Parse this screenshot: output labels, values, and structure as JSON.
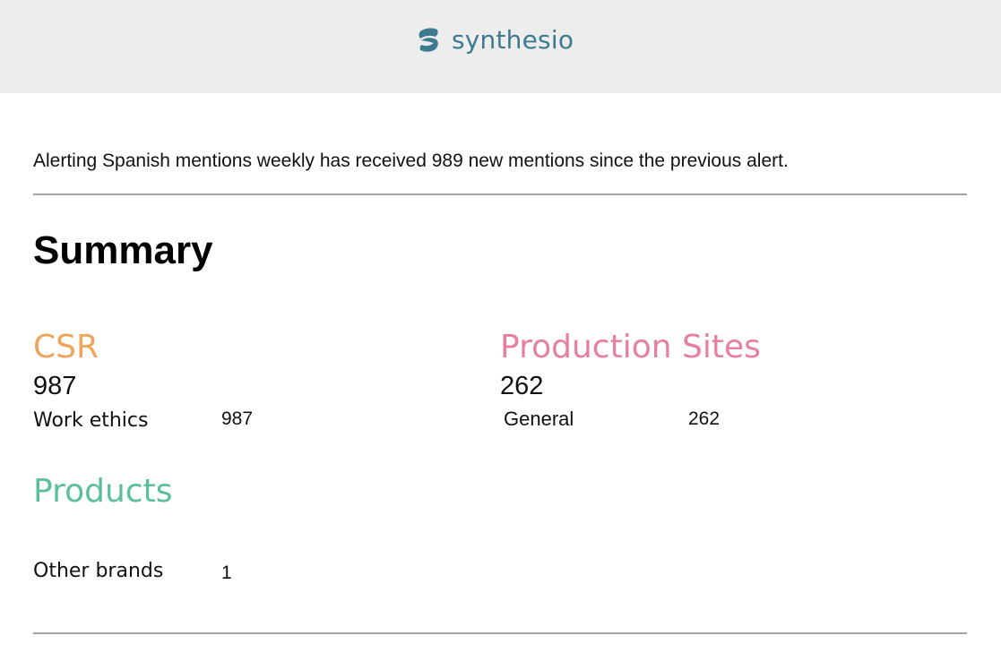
{
  "header": {
    "brand": "synthesio",
    "brand_color": "#3d7a8f",
    "logo_icon": "synthesio-s-icon"
  },
  "intro": "Alerting Spanish mentions weekly has received 989 new mentions since the previous alert.",
  "summary_title": "Summary",
  "groups": [
    {
      "title": "CSR",
      "color": "#f0a45a",
      "total": "987",
      "rows": [
        {
          "label": "Work ethics",
          "value": "987"
        }
      ]
    },
    {
      "title": "Production Sites",
      "color": "#e77fa3",
      "total": "262",
      "rows": [
        {
          "label": "General",
          "value": "262"
        }
      ]
    },
    {
      "title": "Products",
      "color": "#5bbf9e",
      "total": "",
      "rows": [
        {
          "label": "Other brands",
          "value": "1"
        }
      ]
    }
  ]
}
